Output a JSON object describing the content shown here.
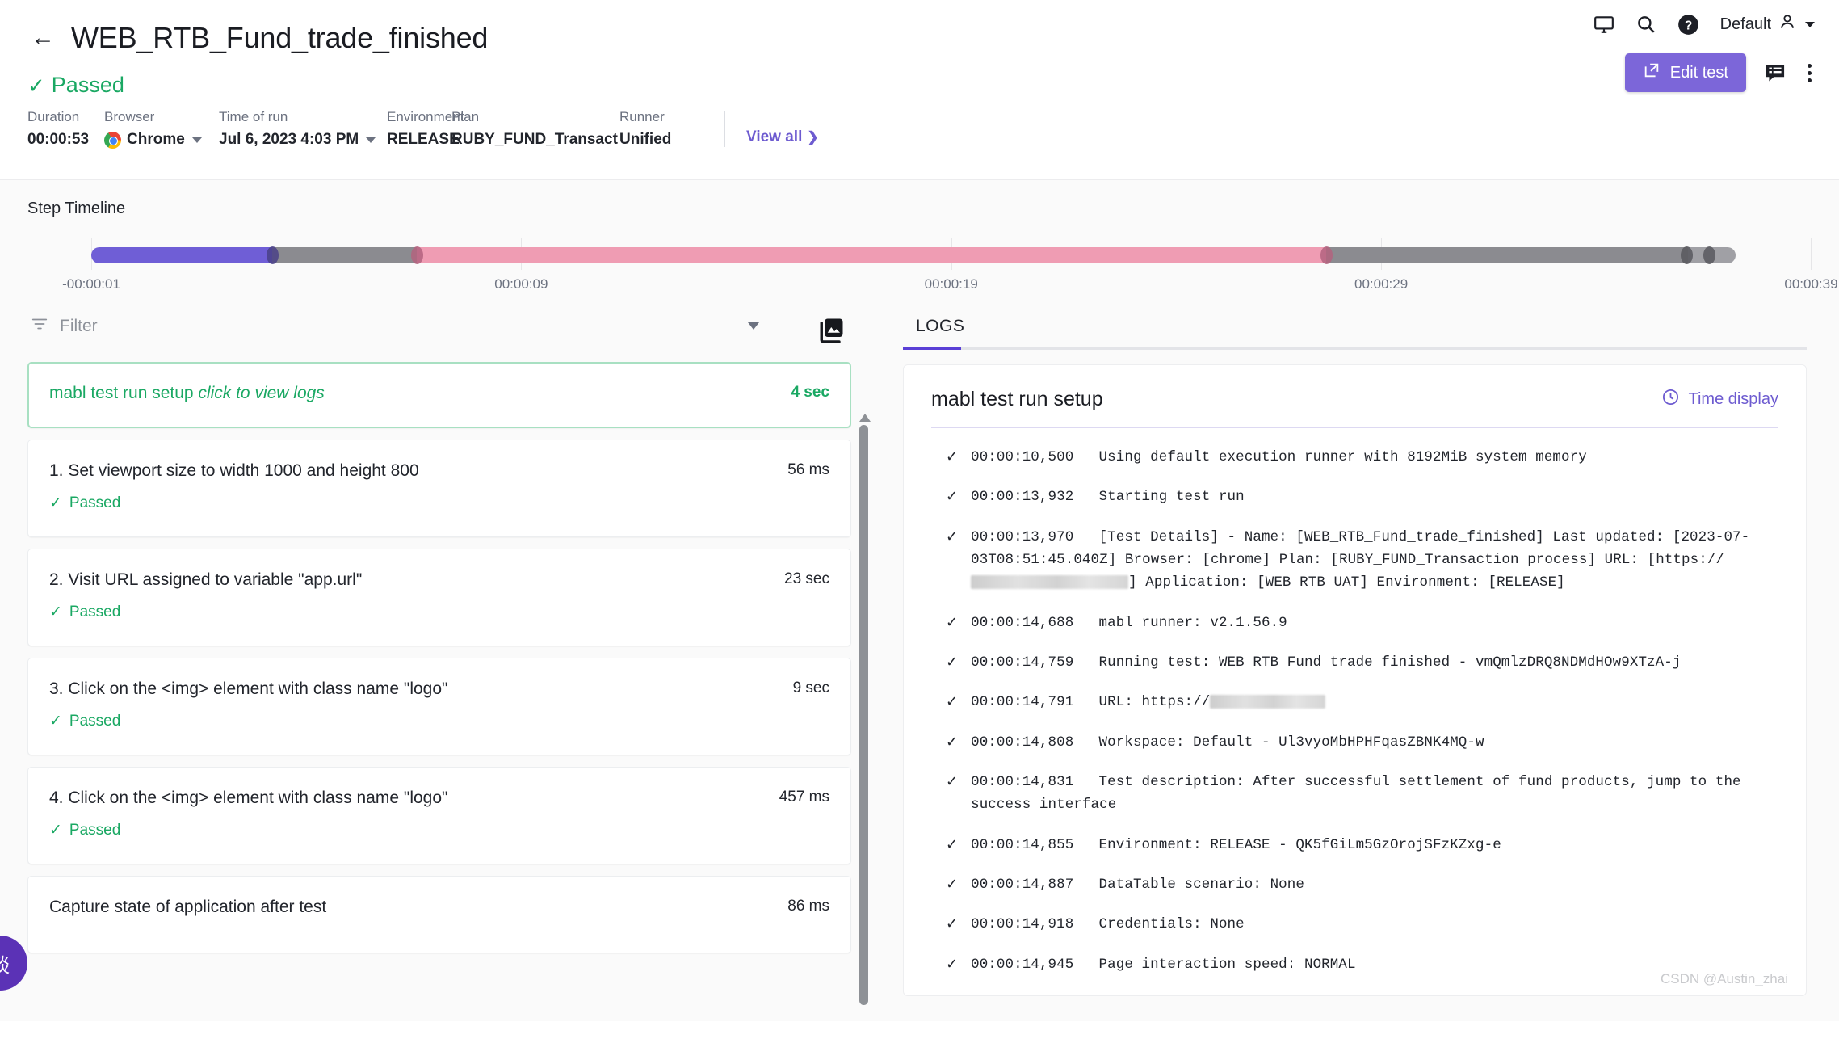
{
  "header": {
    "back_icon": "arrow-left-icon",
    "title": "WEB_RTB_Fund_trade_finished",
    "status": {
      "icon": "check-icon",
      "label": "Passed"
    },
    "meta": [
      {
        "label": "Duration",
        "value": "00:00:53"
      },
      {
        "label": "Browser",
        "value": "Chrome"
      },
      {
        "label": "Time of run",
        "value": "Jul 6, 2023 4:03 PM"
      },
      {
        "label": "Environment",
        "value": "RELEASE"
      },
      {
        "label": "Plan",
        "value": "RUBY_FUND_Transaction process"
      },
      {
        "label": "Runner",
        "value": "Unified"
      }
    ],
    "view_all": "View all",
    "tools": {
      "monitor_icon": "monitor-icon",
      "search_icon": "search-icon",
      "help_icon": "help-circle-icon",
      "account_name": "Default",
      "account_icon": "user-icon",
      "account_caret": "chevron-down-icon"
    },
    "actions": {
      "edit_test": "Edit test",
      "edit_test_icon": "external-link-icon",
      "feedback_icon": "feedback-icon",
      "more_icon": "kebab-menu-icon"
    }
  },
  "timeline": {
    "heading": "Step Timeline",
    "axis_labels": [
      "-00:00:01",
      "00:00:09",
      "00:00:19",
      "00:00:29",
      "00:00:39"
    ],
    "axis_positions_pct": [
      0,
      24.1,
      48.2,
      72.3,
      96.4
    ],
    "colors": {
      "setup": "#6f5ed6",
      "gray": "#8b8b90",
      "pink": "#ef9cb3",
      "dot_purple": "#4a4187",
      "dot_pink": "#b3637f",
      "dot_gray": "#58585e"
    },
    "segments": [
      {
        "name": "setup",
        "color": "#6f5ed6",
        "width_pct": 11.0
      },
      {
        "name": "step-1",
        "color": "#8b8b90",
        "width_pct": 8.8
      },
      {
        "name": "step-2",
        "color": "#ef9cb3",
        "width_pct": 55.3
      },
      {
        "name": "step-3",
        "color": "#8b8b90",
        "width_pct": 22.0
      },
      {
        "name": "step-4",
        "color": "#a0a0a5",
        "width_pct": 2.9
      }
    ],
    "markers_pct": [
      11.0,
      19.8,
      75.1,
      97.0,
      98.4
    ]
  },
  "left_panel": {
    "filter_placeholder": "Filter",
    "filter_icon": "filter-icon",
    "filter_caret": "chevron-down-icon",
    "gallery_icon": "image-gallery-icon",
    "scroll_up_icon": "scroll-up-arrow",
    "steps": [
      {
        "name": "mabl test run setup",
        "hint": "click to view logs",
        "duration": "4 sec",
        "status": null,
        "active": true
      },
      {
        "name": "1. Set viewport size to width 1000 and height 800",
        "hint": "",
        "duration": "56 ms",
        "status": "Passed",
        "active": false
      },
      {
        "name": "2. Visit URL assigned to variable \"app.url\"",
        "hint": "",
        "duration": "23 sec",
        "status": "Passed",
        "active": false
      },
      {
        "name": "3. Click on the <img> element with class name \"logo\"",
        "hint": "",
        "duration": "9 sec",
        "status": "Passed",
        "active": false
      },
      {
        "name": "4. Click on the <img> element with class name \"logo\"",
        "hint": "",
        "duration": "457 ms",
        "status": "Passed",
        "active": false
      },
      {
        "name": "Capture state of application after test",
        "hint": "",
        "duration": "86 ms",
        "status": null,
        "active": false
      }
    ]
  },
  "right_panel": {
    "tabs": [
      {
        "label": "LOGS",
        "active": true
      }
    ],
    "logs_title": "mabl test run setup",
    "time_display": {
      "label": "Time display",
      "icon": "clock-icon"
    },
    "entries": [
      {
        "icon": "check-icon",
        "time": "00:00:10,500",
        "message": "Using default execution runner with 8192MiB system memory"
      },
      {
        "icon": "check-icon",
        "time": "00:00:13,932",
        "message": "Starting test run"
      },
      {
        "icon": "check-icon",
        "time": "00:00:13,970",
        "message": "[Test Details] - Name: [WEB_RTB_Fund_trade_finished] Last updated: [2023-07-03T08:51:45.040Z] Browser: [chrome] Plan: [RUBY_FUND_Transaction process] URL: [https://███████████████] Application: [WEB_RTB_UAT] Environment: [RELEASE]",
        "redacted": true
      },
      {
        "icon": "check-icon",
        "time": "00:00:14,688",
        "message": "mabl runner: v2.1.56.9"
      },
      {
        "icon": "check-icon",
        "time": "00:00:14,759",
        "message": "Running test: WEB_RTB_Fund_trade_finished - vmQmlzDRQ8NDMdHOw9XTzA-j"
      },
      {
        "icon": "check-icon",
        "time": "00:00:14,791",
        "message": "URL: https://███████████",
        "redacted": true
      },
      {
        "icon": "check-icon",
        "time": "00:00:14,808",
        "message": "Workspace: Default - Ul3vyoMbHPHFqasZBNK4MQ-w"
      },
      {
        "icon": "check-icon",
        "time": "00:00:14,831",
        "message": "Test description: After successful settlement of fund products, jump to the success interface"
      },
      {
        "icon": "check-icon",
        "time": "00:00:14,855",
        "message": "Environment: RELEASE - QK5fGiLm5GzOrojSFzKZxg-e"
      },
      {
        "icon": "check-icon",
        "time": "00:00:14,887",
        "message": "DataTable scenario: None"
      },
      {
        "icon": "check-icon",
        "time": "00:00:14,918",
        "message": "Credentials: None"
      },
      {
        "icon": "check-icon",
        "time": "00:00:14,945",
        "message": "Page interaction speed: NORMAL"
      }
    ]
  },
  "fab": {
    "label": "谈",
    "icon": "chat-bubble-icon"
  },
  "watermark": "CSDN @Austin_zhai",
  "theme": {
    "accent": "#7c66d9",
    "success": "#1aa863",
    "link": "#6d5bd0"
  }
}
